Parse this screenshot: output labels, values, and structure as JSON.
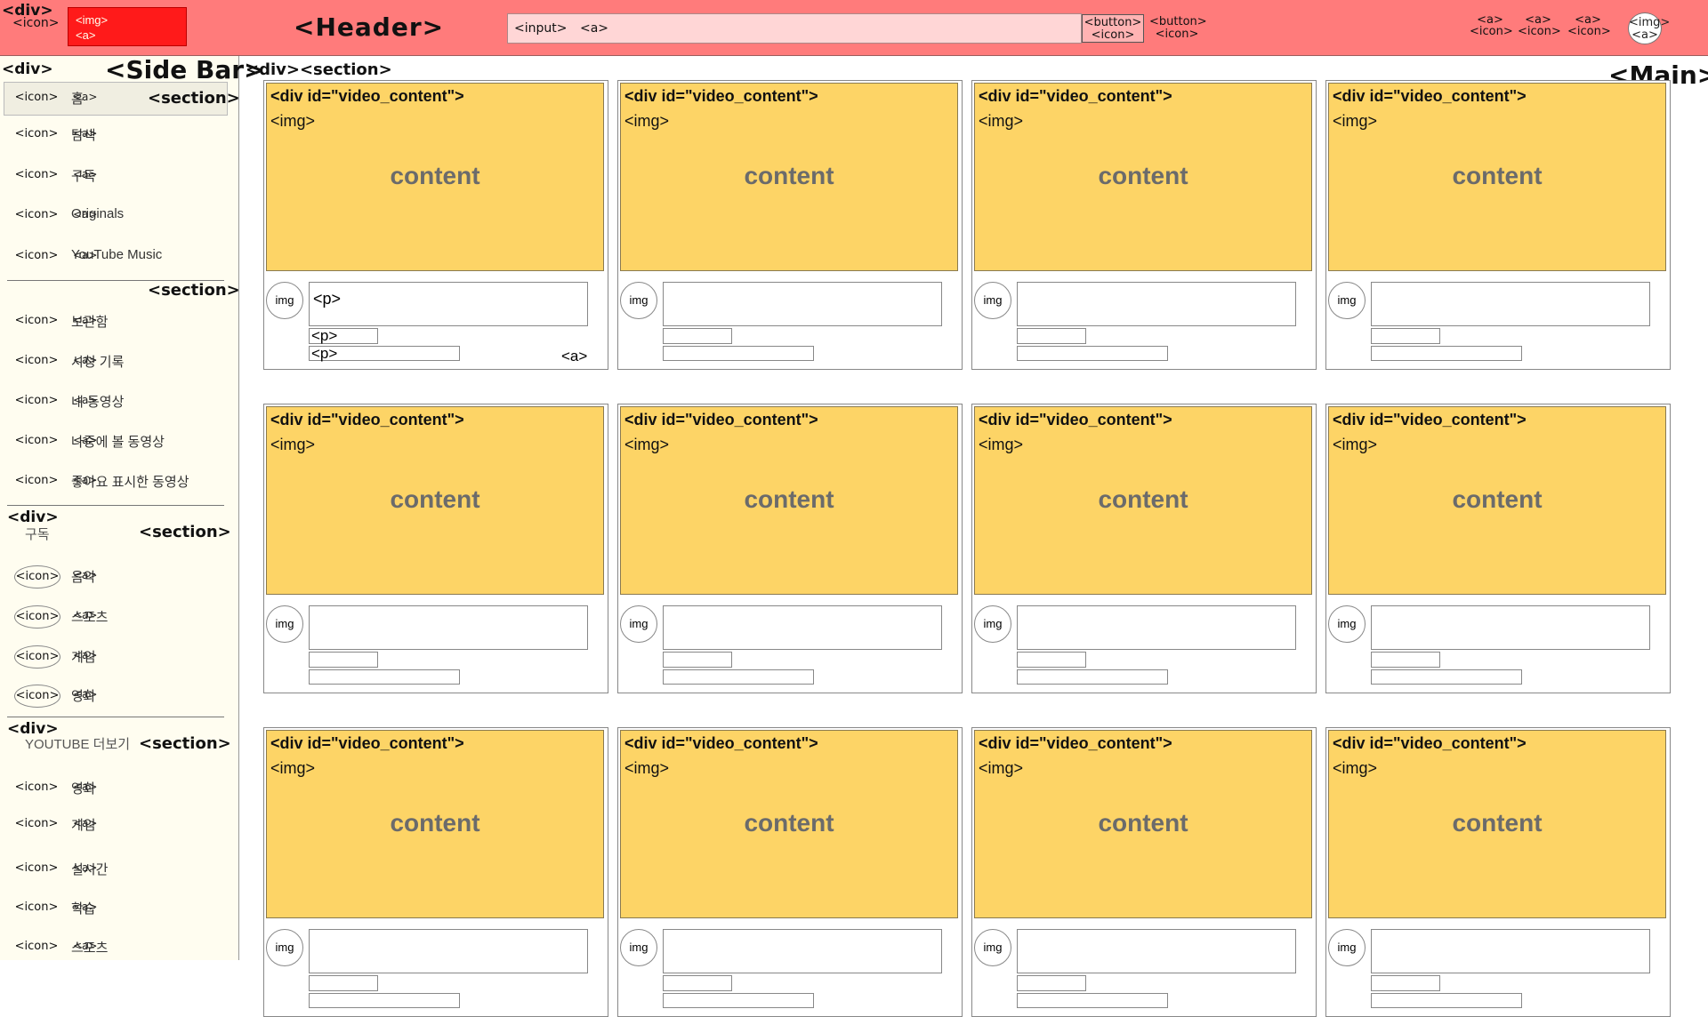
{
  "header": {
    "div_tag": "<div>",
    "menu_icon": "<icon>",
    "logo_lines": [
      "<img>",
      "<a>"
    ],
    "title": "<Header>",
    "search_input": "<input>",
    "search_a": "<a>",
    "search_button_lines": [
      "<button>",
      "<icon>"
    ],
    "voice_button_lines": [
      "<button>",
      "<icon>"
    ],
    "right_icons": [
      {
        "line1": "<a>",
        "line2": "<icon>"
      },
      {
        "line1": "<a>",
        "line2": "<icon>"
      },
      {
        "line1": "<a>",
        "line2": "<icon>"
      }
    ],
    "avatar_lines": [
      "<img>",
      "<a>"
    ]
  },
  "sidebar": {
    "div_tag": "<div>",
    "title": "<Side Bar>",
    "sections": [
      {
        "label": "<section>",
        "items": [
          {
            "icon": "<icon>",
            "label": "홈",
            "tag": "<a>"
          },
          {
            "icon": "<icon>",
            "label": "탐색",
            "tag": "<a>"
          },
          {
            "icon": "<icon>",
            "label": "구독",
            "tag": "<a>"
          },
          {
            "icon": "<icon>",
            "label": "Originals",
            "tag": "<a>"
          },
          {
            "icon": "<icon>",
            "label": "YouTube Music",
            "tag": "<a>"
          }
        ]
      },
      {
        "label": "<section>",
        "items": [
          {
            "icon": "<icon>",
            "label": "보관함",
            "tag": "<a>"
          },
          {
            "icon": "<icon>",
            "label": "시청 기록",
            "tag": "<a>"
          },
          {
            "icon": "<icon>",
            "label": "내 동영상",
            "tag": "<a>"
          },
          {
            "icon": "<icon>",
            "label": "나중에 볼 동영상",
            "tag": "<a>"
          },
          {
            "icon": "<icon>",
            "label": "좋아요 표시한 동영상",
            "tag": "<a>"
          }
        ]
      },
      {
        "div": "<div>",
        "heading": "구독",
        "label": "<section>",
        "items": [
          {
            "icon": "<icon>",
            "label": "음악",
            "tag": "<a>"
          },
          {
            "icon": "<icon>",
            "label": "스포츠",
            "tag": "<a>"
          },
          {
            "icon": "<icon>",
            "label": "게임",
            "tag": "<a>"
          },
          {
            "icon": "<icon>",
            "label": "영화",
            "tag": "<a>"
          }
        ]
      },
      {
        "div": "<div>",
        "heading": "YOUTUBE 더보기",
        "label": "<section>",
        "items": [
          {
            "icon": "<icon>",
            "label": "영화",
            "tag": "<a>"
          },
          {
            "icon": "<icon>",
            "label": "게임",
            "tag": "<a>"
          },
          {
            "icon": "<icon>",
            "label": "실시간",
            "tag": "<a>"
          },
          {
            "icon": "<icon>",
            "label": "학습",
            "tag": "<a>"
          },
          {
            "icon": "<icon>",
            "label": "스포츠",
            "tag": "<a>"
          }
        ]
      }
    ]
  },
  "main": {
    "tag": "<div><section>",
    "title": "<Main>",
    "card": {
      "id_label": "<div id=\"video_content\">",
      "img_label": "<img>",
      "content_label": "content",
      "avatar_label": "img",
      "title_tag": "<p>",
      "channel_tag": "<p>",
      "views_tag": "<p>",
      "link_tag": "<a>"
    },
    "rows": 3,
    "cols": 4
  },
  "colors": {
    "header_bg": "#ff7b7b",
    "logo_bg": "#ff1a1a",
    "search_bg": "#ffd6d6",
    "sidebar_bg": "#fffdf0",
    "thumb_bg": "#fdd466"
  }
}
